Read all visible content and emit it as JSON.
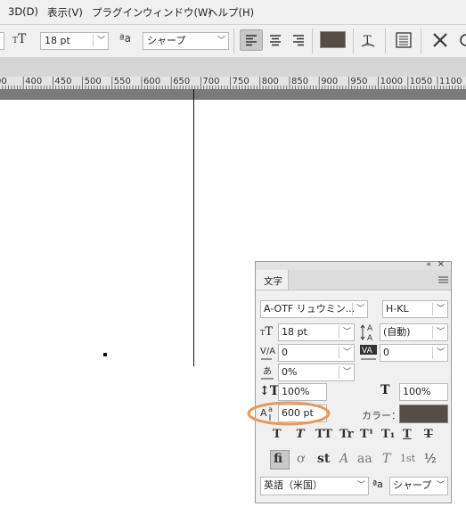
{
  "menu": {
    "items": [
      "3D(D)",
      "表示(V)",
      "プラグイン",
      "ウィンドウ(W)",
      "ヘルプ(H)"
    ]
  },
  "options": {
    "font_size": "18 pt",
    "antialias": "シャープ",
    "aa_icon": "ªa",
    "text_color": "#574d46"
  },
  "ruler": {
    "labels": [
      "00",
      "400",
      "450",
      "500",
      "550",
      "600",
      "650",
      "700",
      "750",
      "800",
      "850",
      "900",
      "950",
      "1000",
      "1050",
      "1100",
      "115"
    ]
  },
  "panel": {
    "tab": "文字",
    "font_family": "A-OTF リュウミン...",
    "font_style": "H-KL",
    "font_size": "18 pt",
    "leading": "(自動)",
    "kerning": "0",
    "tracking": "0",
    "tsume": "0%",
    "vscale": "100%",
    "hscale": "100%",
    "baseline": "600 pt",
    "color_label": "カラー：",
    "color": "#574d46",
    "highlight_color": "#e69a5a",
    "language": "英語（米国）",
    "antialias": "シャープ",
    "aa_icon": "ªa",
    "style_buttons": [
      "T",
      "T",
      "TT",
      "Tr",
      "T¹",
      "T₁",
      "T",
      "T"
    ],
    "opentype_buttons": [
      "fi",
      "ơ",
      "st",
      "A",
      "aa",
      "T",
      "1st",
      "½"
    ]
  }
}
